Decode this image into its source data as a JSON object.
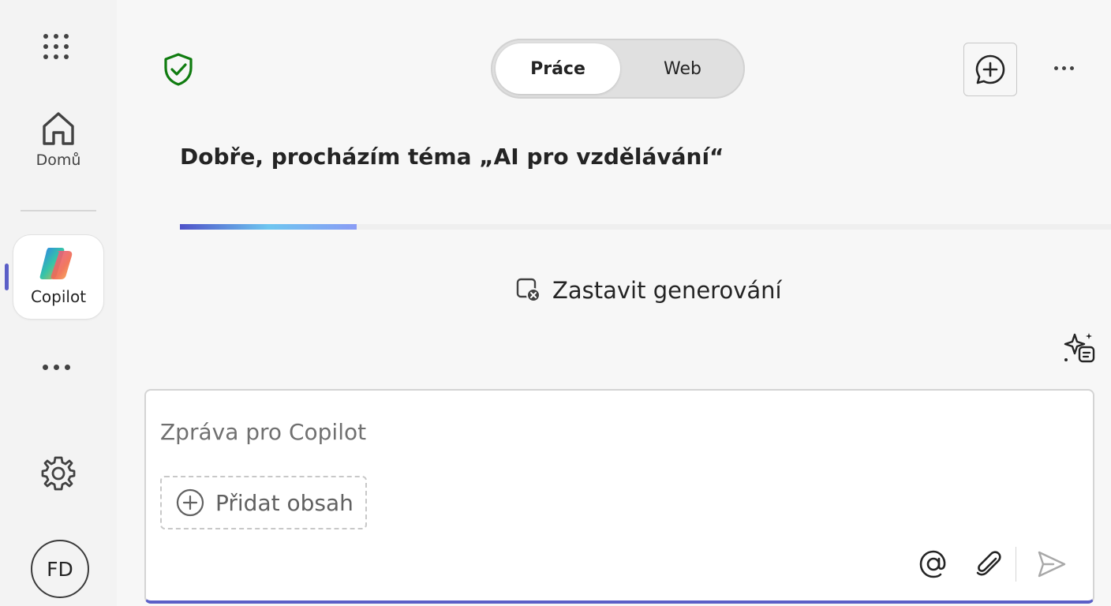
{
  "sidebar": {
    "home_label": "Domů",
    "copilot_label": "Copilot",
    "avatar_initials": "FD",
    "active_indicator_color": "#5b5fc7"
  },
  "header": {
    "mode_toggle": {
      "options": [
        "Práce",
        "Web"
      ],
      "selected": "Práce"
    },
    "icons": [
      "shield-check-icon",
      "new-chat-icon",
      "more-options-icon"
    ]
  },
  "status": {
    "title": "Dobře, procházím téma „AI pro vzdělávání“",
    "progress_fraction": 0.19,
    "stop_label": "Zastavit generování"
  },
  "composer": {
    "placeholder": "Zpráva pro Copilot",
    "value": "",
    "add_content_label": "Přidat obsah",
    "accent_color": "#5b5fc7"
  },
  "colors": {
    "shield": "#107c10",
    "brand": "#5b5fc7"
  }
}
